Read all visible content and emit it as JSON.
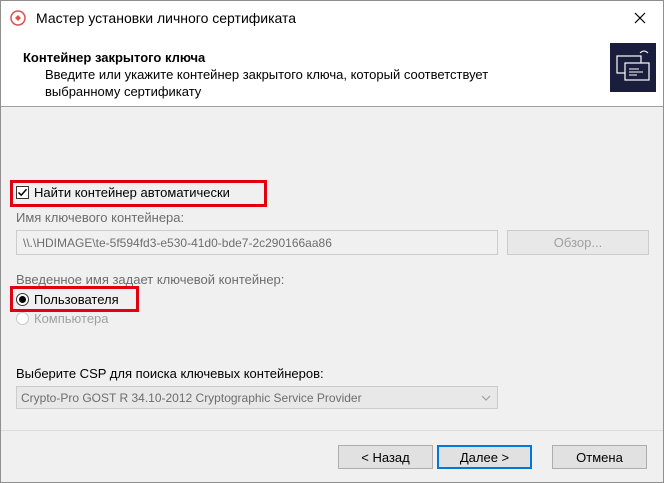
{
  "window": {
    "title": "Мастер установки личного сертификата",
    "close_label": "×"
  },
  "header": {
    "title": "Контейнер закрытого ключа",
    "description": "Введите или укажите контейнер закрытого ключа, который соответствует выбранному сертификату"
  },
  "auto_find": {
    "label": "Найти контейнер автоматически",
    "checked": true
  },
  "container": {
    "label": "Имя ключевого контейнера:",
    "value": "\\\\.\\HDIMAGE\\te-5f594fd3-e530-41d0-bde7-2c290166aa86",
    "browse_label": "Обзор..."
  },
  "owner": {
    "label": "Введенное имя задает ключевой контейнер:",
    "options": [
      {
        "label": "Пользователя",
        "selected": true,
        "enabled": true
      },
      {
        "label": "Компьютера",
        "selected": false,
        "enabled": false
      }
    ]
  },
  "csp": {
    "label": "Выберите CSP для поиска ключевых контейнеров:",
    "selected": "Crypto-Pro GOST R 34.10-2012 Cryptographic Service Provider"
  },
  "buttons": {
    "back": "< Назад",
    "next": "Далее >",
    "cancel": "Отмена"
  },
  "colors": {
    "highlight": "#e0000f",
    "focus": "#0078d7",
    "header_image": "#1a1d3c"
  }
}
